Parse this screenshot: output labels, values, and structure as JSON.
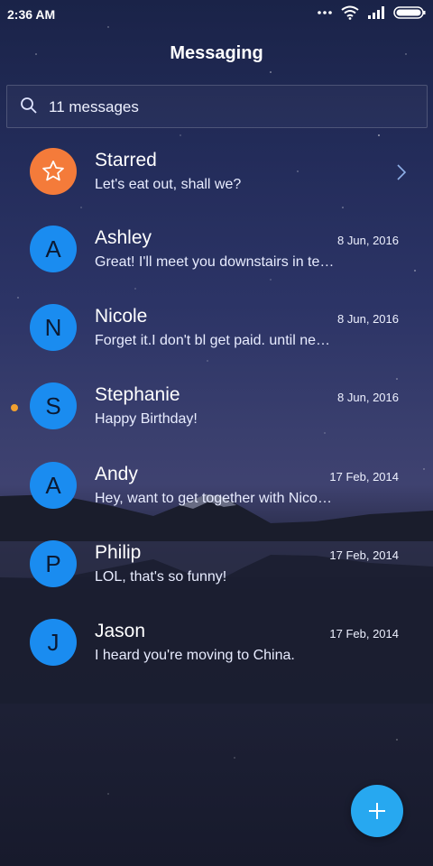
{
  "status_bar": {
    "time": "2:36 AM",
    "icons": [
      "more-dots-icon",
      "wifi-icon",
      "signal-icon",
      "battery-icon"
    ]
  },
  "header": {
    "title": "Messaging"
  },
  "search": {
    "text": "11 messages"
  },
  "conversations": [
    {
      "name": "Starred",
      "preview": "Let's eat out, shall we?",
      "date": "",
      "avatar": "",
      "avatar_icon": "star-icon",
      "avatar_color": "#f47b3a",
      "chevron": true,
      "unread": false
    },
    {
      "name": "Ashley",
      "preview": "Great! I'll meet you downstairs in te…",
      "date": "8 Jun, 2016",
      "avatar": "A",
      "avatar_color": "#1a8cf0",
      "unread": false
    },
    {
      "name": "Nicole",
      "preview": "Forget it.I don't bl get paid. until ne…",
      "date": "8 Jun, 2016",
      "avatar": "N",
      "avatar_color": "#1a8cf0",
      "unread": false
    },
    {
      "name": "Stephanie",
      "preview": "Happy Birthday!",
      "date": "8 Jun, 2016",
      "avatar": "S",
      "avatar_color": "#1a8cf0",
      "unread": true
    },
    {
      "name": "Andy",
      "preview": "Hey, want to get together with Nico…",
      "date": "17 Feb, 2014",
      "avatar": "A",
      "avatar_color": "#1a8cf0",
      "unread": false
    },
    {
      "name": "Philip",
      "preview": "LOL, that's so funny!",
      "date": "17 Feb, 2014",
      "avatar": "P",
      "avatar_color": "#1a8cf0",
      "unread": false
    },
    {
      "name": "Jason",
      "preview": "I heard you're moving to China.",
      "date": "17 Feb, 2014",
      "avatar": "J",
      "avatar_color": "#1a8cf0",
      "unread": false
    }
  ],
  "fab": {
    "icon": "plus-icon",
    "color": "#27a8f0"
  },
  "colors": {
    "unread_dot": "#f0a030",
    "avatar_default": "#1a8cf0",
    "starred": "#f47b3a"
  }
}
